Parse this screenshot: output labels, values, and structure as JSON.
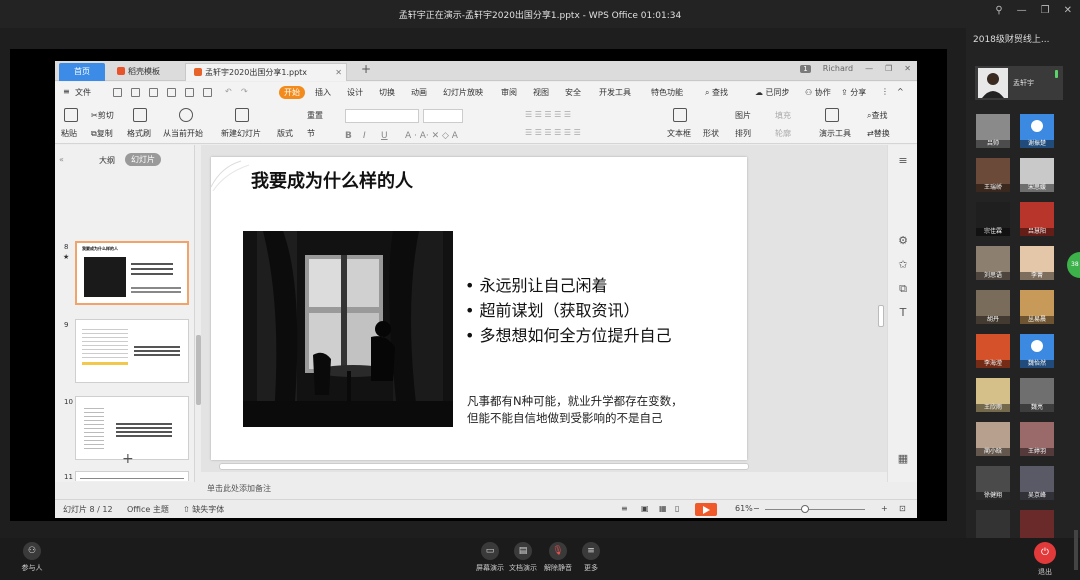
{
  "meeting": {
    "title": "孟轩宇正在演示-孟轩宇2020出国分享1.pptx - WPS Office 01:01:34"
  },
  "window": {
    "pin_icon": "pin-icon",
    "minimize": "—",
    "restore": "❐",
    "close": "✕"
  },
  "wps": {
    "tabs": {
      "home": "首页",
      "templates": "稻壳模板",
      "file": "孟轩宇2020出国分享1.pptx",
      "close": "✕",
      "add": "+"
    },
    "titlebar_right": {
      "badge": "1",
      "user": "Richard",
      "min": "—",
      "restore": "❐",
      "close": "✕"
    },
    "menu": {
      "file": "文件",
      "start": "开始",
      "insert": "插入",
      "design": "设计",
      "transition": "切换",
      "animation": "动画",
      "slideshow": "幻灯片放映",
      "review": "审阅",
      "view": "视图",
      "security": "安全",
      "devtools": "开发工具",
      "special": "特色功能",
      "search": "查找",
      "sync": "已同步",
      "collab": "协作",
      "share": "分享"
    },
    "ribbon": {
      "paste": "粘贴",
      "cut": "剪切",
      "copy": "复制",
      "format_painter": "格式刷",
      "from_current": "从当前开始",
      "new_slide": "新建幻灯片",
      "layout": "版式",
      "section": "节",
      "reset": "重置",
      "bold": "B",
      "italic": "I",
      "underline": "U",
      "textbox": "文本框",
      "shape": "形状",
      "arrange": "排列",
      "picture": "图片",
      "fill": "填充",
      "outline": "轮廓",
      "presenter_tools": "演示工具",
      "find": "查找",
      "replace": "替换"
    },
    "panel": {
      "outline": "大纲",
      "slides": "幻灯片",
      "collapse": "«",
      "add": "+"
    },
    "thumbnails": [
      {
        "num": "8",
        "star": "★",
        "title": "我要成为什么样的人",
        "active": true
      },
      {
        "num": "9",
        "star": "",
        "title": "",
        "active": false
      },
      {
        "num": "10",
        "star": "",
        "title": "",
        "active": false
      },
      {
        "num": "11",
        "star": "",
        "title": "",
        "active": false
      }
    ],
    "slide": {
      "title": "我要成为什么样的人",
      "bullets": [
        "• 永远别让自己闲着",
        "• 超前谋划（获取资讯）",
        "• 多想想如何全方位提升自己"
      ],
      "note_lines": [
        "凡事都有N种可能，就业升学都存在变数，",
        "但能不能自信地做到受影响的不是自己"
      ]
    },
    "notes_placeholder": "单击此处添加备注",
    "status": {
      "slide_count": "幻灯片 8 / 12",
      "theme": "Office 主题",
      "missing_font": "缺失字体",
      "zoom": "61%",
      "zoom_minus": "−",
      "zoom_plus": "+"
    }
  },
  "participants": {
    "header": "2018级财贸线上...",
    "presenter_name": "孟轩宇",
    "people": [
      {
        "name": "吕帅",
        "color": "#8a8a8a",
        "blue": false
      },
      {
        "name": "谢振楚",
        "color": "#3b89e0",
        "blue": true
      },
      {
        "name": "王瑞峤",
        "color": "#6b4a3a",
        "blue": false
      },
      {
        "name": "宋思媛",
        "color": "#c9c9c9",
        "blue": false
      },
      {
        "name": "宗佳霖",
        "color": "#1f1f1f",
        "blue": false
      },
      {
        "name": "吕慧阳",
        "color": "#b8352b",
        "blue": false
      },
      {
        "name": "刘思语",
        "color": "#8c7f70",
        "blue": false
      },
      {
        "name": "李菁",
        "color": "#e3c7a8",
        "blue": false
      },
      {
        "name": "胡丹",
        "color": "#7a6c5a",
        "blue": false
      },
      {
        "name": "丛易晨",
        "color": "#c89a5a",
        "blue": false
      },
      {
        "name": "李海滢",
        "color": "#d4512a",
        "blue": false
      },
      {
        "name": "魏怡然",
        "color": "#3b89e0",
        "blue": true
      },
      {
        "name": "王欣雨",
        "color": "#d6c08a",
        "blue": false
      },
      {
        "name": "魏亮",
        "color": "#6f6f6f",
        "blue": false
      },
      {
        "name": "蔺小晗",
        "color": "#b7a08e",
        "blue": false
      },
      {
        "name": "王婷羽",
        "color": "#9a6a6a",
        "blue": false
      },
      {
        "name": "徐健翔",
        "color": "#4a4a4a",
        "blue": false
      },
      {
        "name": "吴京峰",
        "color": "#5a5a66",
        "blue": false
      },
      {
        "name": "",
        "color": "#333333",
        "blue": false
      },
      {
        "name": "",
        "color": "#6a2a2a",
        "blue": false
      }
    ],
    "indicator": "38"
  },
  "bottom": {
    "participants": "参与人",
    "screen_share": "屏幕演示",
    "doc_share": "文档演示",
    "unmute": "解除静音",
    "more": "更多",
    "leave": "退出"
  }
}
